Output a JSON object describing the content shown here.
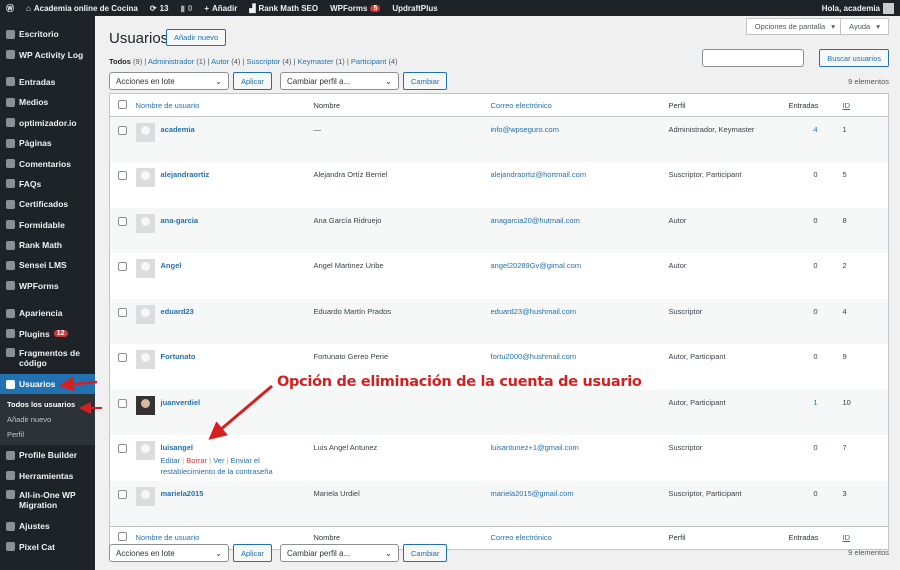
{
  "adminbar": {
    "site": "Academia online de Cocina",
    "updates": "13",
    "comments": "0",
    "add": "Añadir",
    "rankmath": "Rank Math SEO",
    "wpforms": "WPForms",
    "wpforms_badge": "5",
    "updraft": "UpdraftPlus",
    "greeting": "Hola, academia"
  },
  "sidebar": {
    "items": [
      "Escritorio",
      "WP Activity Log",
      "Entradas",
      "Medios",
      "optimizador.io",
      "Páginas",
      "Comentarios",
      "FAQs",
      "Certificados",
      "Formidable",
      "Rank Math",
      "Sensei LMS",
      "WPForms",
      "Apariencia",
      "Plugins",
      "Fragmentos de código",
      "Usuarios",
      "Profile Builder",
      "Herramientas",
      "All-in-One WP Migration",
      "Ajustes",
      "Pixel Cat"
    ],
    "plugins_badge": "12",
    "submenu": [
      "Todos los usuarios",
      "Añadir nuevo",
      "Perfil"
    ]
  },
  "header": {
    "title": "Usuarios",
    "add_new": "Añadir nuevo",
    "screen_options": "Opciones de pantalla",
    "help": "Ayuda",
    "search_button": "Buscar usuarios"
  },
  "views": [
    {
      "label": "Todos",
      "count": "(9)"
    },
    {
      "label": "Administrador",
      "count": "(1)"
    },
    {
      "label": "Autor",
      "count": "(4)"
    },
    {
      "label": "Suscriptor",
      "count": "(4)"
    },
    {
      "label": "Keymaster",
      "count": "(1)"
    },
    {
      "label": "Participant",
      "count": "(4)"
    }
  ],
  "bulk": {
    "actions": "Acciones en lote",
    "apply": "Aplicar",
    "role": "Cambiar perfil a...",
    "change": "Cambiar",
    "count": "9 elementos"
  },
  "columns": [
    "Nombre de usuario",
    "Nombre",
    "Correo electrónico",
    "Perfil",
    "Entradas",
    "ID"
  ],
  "users": [
    {
      "username": "academia",
      "name": "—",
      "email": "info@wpseguro.com",
      "role": "Administrador, Keymaster",
      "posts": "4",
      "id": "1"
    },
    {
      "username": "alejandraortiz",
      "name": "Alejandra Ortíz Berriel",
      "email": "alejandraortiz@hortmail.com",
      "role": "Suscriptor, Participant",
      "posts": "0",
      "id": "5"
    },
    {
      "username": "ana-garcia",
      "name": "Ana García Ridruejo",
      "email": "anagarcia20@hutmail.com",
      "role": "Autor",
      "posts": "0",
      "id": "8"
    },
    {
      "username": "Angel",
      "name": "Angel Martinez Uribe",
      "email": "angel20289Gv@gimal.com",
      "role": "Autor",
      "posts": "0",
      "id": "2"
    },
    {
      "username": "eduard23",
      "name": "Eduardo Martín Prados",
      "email": "eduard23@hushmail.com",
      "role": "Suscriptor",
      "posts": "0",
      "id": "4"
    },
    {
      "username": "Fortunato",
      "name": "Fortunato Gereo Perie",
      "email": "fortu2000@hushmail.com",
      "role": "Autor, Participant",
      "posts": "0",
      "id": "9"
    },
    {
      "username": "juanverdiel",
      "name": "",
      "email": "",
      "role": "Autor, Participant",
      "posts": "1",
      "id": "10"
    },
    {
      "username": "luisangel",
      "name": "Luis Angel Antunez",
      "email": "luisantunez+1@gmail.com",
      "role": "Suscriptor",
      "posts": "0",
      "id": "7"
    },
    {
      "username": "mariela2015",
      "name": "Mariela Urdiel",
      "email": "mariela2015@gmail.com",
      "role": "Suscriptor, Participant",
      "posts": "0",
      "id": "3"
    }
  ],
  "row_actions": {
    "edit": "Editar",
    "delete": "Borrar",
    "view": "Ver",
    "reset": "Enviar el restablecimiento de la contraseña"
  },
  "annotation": "Opción de eliminación de la cuenta de usuario",
  "colors": {
    "accent": "#2271b1",
    "annotation": "#d61f1f",
    "sidebar": "#1d2327"
  }
}
